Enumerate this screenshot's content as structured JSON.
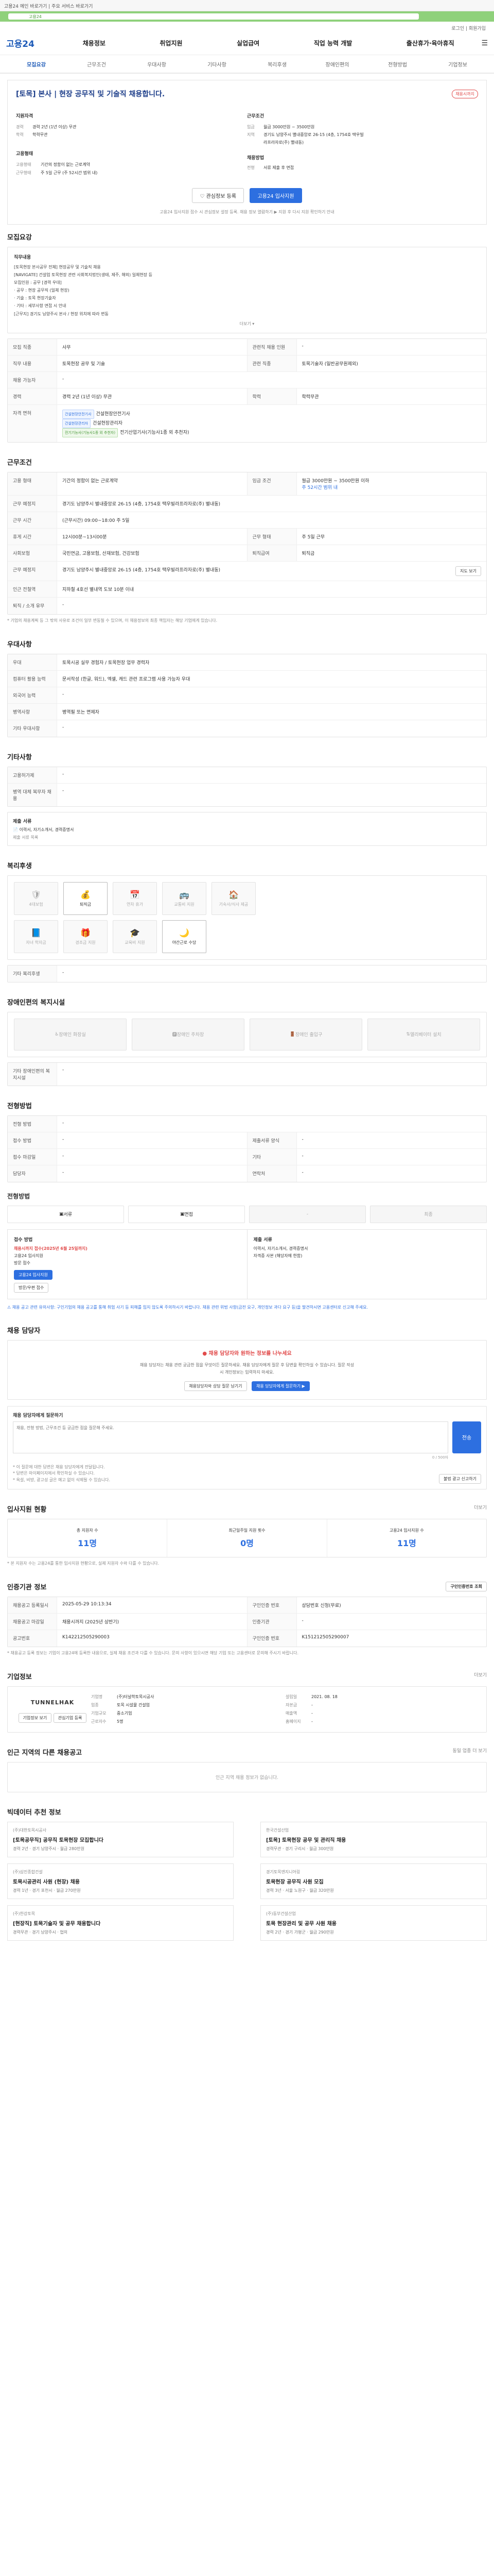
{
  "topbar": {
    "text": "고용24 메인 바로가기 | 주요 서비스 바로가기"
  },
  "banner": {
    "label": "고용24"
  },
  "login": {
    "text": "로그인 | 회원가입"
  },
  "header": {
    "logo": "고용24",
    "gnb": [
      "채용정보",
      "취업지원",
      "실업급여",
      "직업 능력 개발",
      "출산휴가·육아휴직"
    ]
  },
  "subnav": [
    "모집요강",
    "근무조건",
    "우대사항",
    "기타사항",
    "복리후생",
    "장애인편의",
    "전형방법",
    "기업정보"
  ],
  "job": {
    "title": "[토목] 본사 | 현장 공무직 및 기술직 채용합니다.",
    "dday": "채용시까지",
    "apply_label": "지원자격",
    "career_k": "경력",
    "career_v": "경력 2년 (1년 이상) 무관",
    "edu_k": "학력",
    "edu_v": "학력무관",
    "cond_label": "근무조건",
    "salary_k": "임금",
    "salary_v": "월급 3000만원 ~ 3500만원",
    "region_k": "지역",
    "region_v": "경기도 남양주시 별내중앙로 26-15 (4층, 1754호 택우빌라프라자로(주) 별내동)",
    "type_label": "고용형태",
    "type_k": "고용형태",
    "type_v": "기간의 정함이 없는 근로계약",
    "worktype_k": "근무형태",
    "worktype_v": "주 5일 근무 (주 52시간 범위 내)",
    "method_label": "채용방법",
    "method_k": "전형",
    "method_v": "서류 제출 후 면접",
    "btn_interest": "관심정보 등록",
    "btn_apply": "고용24 입사지원",
    "note": "고용24 입사지원 접수 시 관심정보 설정 등록. 채용 정보 열람하기 ▶ 지원 후 다시 지원 확인하기 안내"
  },
  "recruit": {
    "title": "모집요강",
    "more": "더보기 ▾",
    "duty_k": "직무내용",
    "duty_v": "[토목현장 본사공무 전체] 현장공무 및 기술직 채용\n[NAVIGATE] 건설업 토목현장 관련 사회복지법인(생태, 제주, 해외) 일체현장 등\n모집인원 : 공무 [경력 우대]\n· 공무 : 현장 공무직 (일체 현장)\n· 기술 : 토목 현장기술자\n· 기타 : 세부사항 면접 시 안내\n[근무지] 경기도 남양주시 본사 / 현장 위치에 따라 변동",
    "rows": [
      {
        "k": "모집 직종",
        "v": "사무",
        "k2": "관련직 채용 인원",
        "v2": "-"
      },
      {
        "k": "직무 내용",
        "v": "토목현장 공무 및 기술",
        "k2": "관련 직종",
        "v2": "토목기술자 (일반공무원제외)"
      },
      {
        "k": "채용 가능자",
        "v": "-",
        "k2": "",
        "v2": ""
      },
      {
        "k": "경력",
        "v": "경력 2년 (1년 이상) 무관",
        "k2": "학력",
        "v2": "학력무관"
      }
    ],
    "license_k": "자격 면허",
    "license_tags": [
      "건설현장안전기사",
      "건설현장관리자",
      "전기기능사(기능사1종 외 추천자)"
    ],
    "license_texts": [
      "건설현장안전기사",
      "건설현장관리자",
      "전기산업기사(기능사1종 외 추천자)"
    ]
  },
  "work": {
    "title": "근무조건",
    "rows": [
      {
        "k": "고용 형태",
        "v": "기간의 정함이 없는 근로계약",
        "k2": "임금 조건",
        "v2": "월급 3000만원 ~ 3500만원 이하"
      },
      {
        "k": "근무 예정지",
        "v": "경기도 남양주시 별내중앙로 26-15 (4층, 1754호 택우빌라프라자로(주) 별내동)",
        "k2": "",
        "v2": ""
      },
      {
        "k": "근무 시간",
        "v": "(근무시간) 09:00~18:00 주 5일",
        "k2": "",
        "v2": ""
      },
      {
        "k": "휴게 시간",
        "v": "12시00분~13시00분",
        "k2": "근무 형태",
        "v2": "주 5일 근무"
      },
      {
        "k": "사회보험",
        "v": "국민연금, 고용보험, 산재보험, 건강보험",
        "k2": "퇴직급여",
        "v2": "퇴직금"
      },
      {
        "k": "근무 예정지",
        "v": "경기도 남양주시 별내중앙로 26-15 (4층, 1754호 택우빌라프라자로(주) 별내동)",
        "k2": "",
        "v2": ""
      },
      {
        "k": "인근 전철역",
        "v": "지하철 4호선 별내역 도보 10분 이내",
        "k2": "",
        "v2": ""
      },
      {
        "k": "퇴직 / 소개 유무",
        "v": "-",
        "k2": "",
        "v2": ""
      }
    ],
    "salary_note": "주 52시간 범위 내",
    "map_btn": "지도 보기",
    "note": "* 기업의 채용계획 등 그 밖의 사유로 조건이 일부 변동될 수 있으며, 이 채용정보의 최종 책임자는 해당 기업에게 있습니다."
  },
  "pref": {
    "title": "우대사항",
    "rows": [
      {
        "k": "우대",
        "v": "토목시공 실무 경험자 / 토목현장 업무 경력자"
      },
      {
        "k": "컴퓨터 활용 능력",
        "v": "문서작성 (한글, 워드), 엑셀, 캐드 관련 프로그램 사용 가능자 우대"
      },
      {
        "k": "외국어 능력",
        "v": "-"
      },
      {
        "k": "병역사항",
        "v": "병역필 또는 면제자"
      },
      {
        "k": "기타 우대사항",
        "v": "-"
      }
    ]
  },
  "etc": {
    "title": "기타사항",
    "rows": [
      {
        "k": "고용허가제",
        "v": "-"
      },
      {
        "k": "병역 대체 복무자 채용",
        "v": "-"
      }
    ],
    "doc_k": "제출 서류",
    "doc_v": "이력서, 자기소개서, 경력증명서",
    "docs_label": "제출 서류 목록"
  },
  "benefit": {
    "title": "복리후생",
    "items": [
      {
        "label": "4대보험",
        "icon": "shield",
        "on": false
      },
      {
        "label": "퇴직금",
        "icon": "coin",
        "on": true
      },
      {
        "label": "연차 휴가",
        "icon": "calendar",
        "on": false
      },
      {
        "label": "교통비 지원",
        "icon": "bus",
        "on": false
      },
      {
        "label": "기숙사/식사 제공",
        "icon": "home",
        "on": false
      },
      {
        "label": "자녀 학자금",
        "icon": "book",
        "on": false
      },
      {
        "label": "경조금 지원",
        "icon": "gift",
        "on": false
      },
      {
        "label": "교육비 지원",
        "icon": "grad",
        "on": false
      },
      {
        "label": "야간근로 수당",
        "icon": "moon",
        "on": true
      }
    ],
    "other_k": "기타 복리후생",
    "other_v": "-"
  },
  "disabled": {
    "title": "장애인편의 복지시설",
    "cards": [
      "장애인 화장실",
      "장애인 주차장",
      "장애인 출입구",
      "엘리베이터 설치"
    ],
    "other_k": "기타 장애인편의 복지시설",
    "other_v": "-"
  },
  "screening": {
    "title": "전형방법",
    "rows": [
      {
        "k": "전형 방법",
        "v": "-",
        "k2": "",
        "v2": ""
      },
      {
        "k": "접수 방법",
        "v": "-",
        "k2": "제출서류 양식",
        "v2": "-"
      },
      {
        "k": "접수 마감일",
        "v": "-",
        "k2": "기타",
        "v2": "-"
      },
      {
        "k": "담당자",
        "v": "-",
        "k2": "연락처",
        "v2": "-"
      }
    ],
    "steps_label": "전형방법",
    "steps": [
      "서류",
      "면접",
      "-",
      "최종"
    ],
    "apply_box_title": "접수 방법",
    "apply_box_lines": [
      "채용시까지 접수(2025년 6월 25일까지)",
      "고용24 입사지원",
      "방문 접수"
    ],
    "apply_box_btn1": "고용24 입사지원",
    "apply_box_btn2": "방문/우편 접수",
    "doc_box_title": "제출 서류",
    "doc_box_lines": [
      "이력서, 자기소개서, 경력증명서",
      "자격증 사본 (해당자에 한함)"
    ],
    "warn": "⚠ 채용 공고 관련 유의사항: 구인기업의 채용 공고를 통해 취업 사기 등 피해를 입지 않도록 주의하시기 바랍니다. 채용 관련 위법 사항(금전 요구, 개인정보 과다 요구 등)을 발견하시면 고용센터로 신고해 주세요."
  },
  "contact": {
    "title": "채용 담당자",
    "notice_title": "채용 담당자와 원하는 정보를 나누세요",
    "notice_text": "채용 담당자는 채용 관련 궁금한 점을 무엇이든 질문하세요. 채용 담당자에게 질문 후 답변을 확인하실 수 있습니다. 질문 작성 시 개인정보는 입력하지 마세요.",
    "btn1": "채용담당자와 상담 질문 남기기",
    "btn2": "채용 담당자에게 질문하기 ▶",
    "q_label": "채용 담당자에게 질문하기",
    "q_placeholder": "채용, 전형 방법, 근무조건 등 궁금한 점을 질문해 주세요.",
    "q_count": "0 / 500자",
    "q_submit": "전송",
    "notes": "* 이 질문에 대한 답변은 채용 담당자에게 전달됩니다.\n* 답변은 마이페이지에서 확인하실 수 있습니다.\n* 욕설, 비방, 광고성 글은 예고 없이 삭제될 수 있습니다.",
    "report_btn": "불법 광고 신고하기"
  },
  "stats": {
    "title": "입사지원 현황",
    "more": "더보기",
    "items": [
      {
        "label": "총 지원자 수",
        "value": "11명"
      },
      {
        "label": "최근일주일 지원 횟수",
        "value": "0명"
      },
      {
        "label": "고용24 입사지원 수",
        "value": "11명"
      }
    ],
    "note": "* 본 지원자 수는 고용24를 통한 입사지원 현황으로, 실제 지원자 수와 다를 수 있습니다."
  },
  "certinfo": {
    "title": "인증기관 정보",
    "btn": "구인인증번호 조회",
    "rows": [
      {
        "k": "채용공고 등록일시",
        "v": "2025-05-29 10:13:34",
        "k2": "구인인증 번호",
        "v2": "상담번호 신청(무료)"
      },
      {
        "k": "채용공고 마감일",
        "v": "채용시까지 (2025년 상반기)",
        "k2": "인증기관",
        "v2": "-"
      },
      {
        "k": "공고번호",
        "v": "K142212505290003",
        "k2": "구인인증 번호",
        "v2": "K151212505290007"
      }
    ],
    "note": "* 채용공고 등록 정보는 기업이 고용24에 등록한 내용으로, 실제 채용 조건과 다를 수 있습니다. 문의 사항이 있으시면 해당 기업 또는 고용센터로 문의해 주시기 바랍니다."
  },
  "company": {
    "title": "기업정보",
    "more": "더보기",
    "logo": "TUNNELHAK",
    "name_k": "기업명",
    "name_v": "(주)터널학토목시공사",
    "type_k": "업종",
    "type_v": "토목 시설물 건설업",
    "size_k": "기업규모",
    "size_v": "중소기업",
    "emp_k": "근로자수",
    "emp_v": "5명",
    "found_k": "설립일",
    "found_v": "2021. 08. 18",
    "cap_k": "자본금",
    "cap_v": "-",
    "sales_k": "매출액",
    "sales_v": "-",
    "hp_k": "홈페이지",
    "hp_v": "-",
    "btn1": "기업정보 보기",
    "btn2": "관심기업 등록"
  },
  "others": {
    "title": "인근 지역의 다른 채용공고",
    "more": "동일 업종 더 보기",
    "empty": "인근 지역 채용 정보가 없습니다."
  },
  "related": {
    "title": "빅데이터 추천 정보",
    "cards": [
      {
        "co": "(주)대한토목시공사",
        "title": "[토목공무직] 공무직 토목현장 모집합니다",
        "meta": "경력 2년 · 경기 남양주시 · 월급 280만원"
      },
      {
        "co": "한국건설산업",
        "title": "[토목] 토목현장 공무 및 관리직 채용",
        "meta": "경력무관 · 경기 구리시 · 월급 300만원"
      },
      {
        "co": "(주)삼진종합건설",
        "title": "토목시공관리 사원 (현장) 채용",
        "meta": "경력 1년 · 경기 포천시 · 월급 270만원"
      },
      {
        "co": "경기토목엔지니어링",
        "title": "토목현장 공무직 사원 모집",
        "meta": "경력 3년 · 서울 노원구 · 월급 320만원"
      },
      {
        "co": "(주)한강토목",
        "title": "[현장직] 토목기술자 및 공무 채용합니다",
        "meta": "경력무관 · 경기 남양주시 · 협의"
      },
      {
        "co": "(주)동부건설산업",
        "title": "토목 현장관리 및 공무 사원 채용",
        "meta": "경력 2년 · 경기 가평군 · 월급 290만원"
      }
    ]
  }
}
